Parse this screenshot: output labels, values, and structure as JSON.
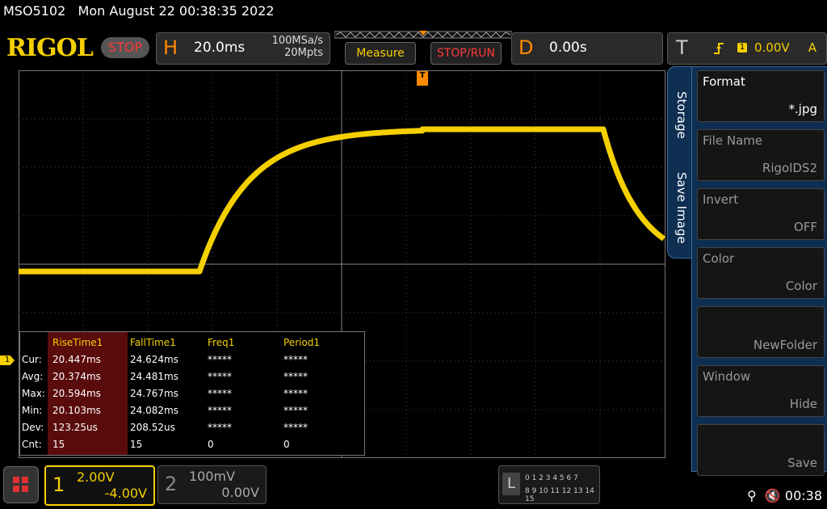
{
  "header": {
    "model": "MSO5102",
    "datetime": "Mon August 22 00:38:35 2022"
  },
  "logo": "RIGOL",
  "run_state": "STOP",
  "horizontal": {
    "letter": "H",
    "timebase": "20.0ms",
    "sample_rate": "100MSa/s",
    "memory_depth": "20Mpts"
  },
  "buttons": {
    "measure": "Measure",
    "stop_run": "STOP/RUN"
  },
  "delay": {
    "letter": "D",
    "value": "0.00s"
  },
  "trigger": {
    "letter": "T",
    "source": "1",
    "level": "0.00V",
    "mode": "A"
  },
  "markers": {
    "trigger": "T",
    "ch1": "1"
  },
  "measurements": {
    "row_labels": [
      "Cur:",
      "Avg:",
      "Max:",
      "Min:",
      "Dev:",
      "Cnt:"
    ],
    "columns": [
      {
        "name": "RiseTime1",
        "values": [
          "20.447ms",
          "20.374ms",
          "20.594ms",
          "20.103ms",
          "123.25us",
          "15"
        ]
      },
      {
        "name": "FallTime1",
        "values": [
          "24.624ms",
          "24.481ms",
          "24.767ms",
          "24.082ms",
          "208.52us",
          "15"
        ]
      },
      {
        "name": "Freq1",
        "values": [
          "*****",
          "*****",
          "*****",
          "*****",
          "*****",
          "0"
        ]
      },
      {
        "name": "Period1",
        "values": [
          "*****",
          "*****",
          "*****",
          "*****",
          "*****",
          "0"
        ]
      }
    ]
  },
  "side_tabs": {
    "storage": "Storage",
    "save_image": "Save Image"
  },
  "side_menu": [
    {
      "key": "Format",
      "value": "*.jpg"
    },
    {
      "key": "File Name",
      "value": "RigolDS2"
    },
    {
      "key": "Invert",
      "value": "OFF"
    },
    {
      "key": "Color",
      "value": "Color"
    },
    {
      "key": "",
      "value": "NewFolder"
    },
    {
      "key": "Window",
      "value": "Hide"
    },
    {
      "key": "",
      "value": "Save"
    }
  ],
  "channels": [
    {
      "number": "1",
      "scale": "2.00V",
      "offset": "-4.00V"
    },
    {
      "number": "2",
      "scale": "100mV",
      "offset": "0.00V"
    }
  ],
  "logic": {
    "letter": "L",
    "row1": "0 1 2 3  4 5 6 7",
    "row2": "8 9 10 11 12 13 14 15"
  },
  "status": {
    "time": "00:38"
  },
  "colors": {
    "ch1": "#f5d000",
    "trigger": "#ff8a00",
    "stop": "#ff3a3a",
    "menu_bg": "#0f2f52"
  }
}
